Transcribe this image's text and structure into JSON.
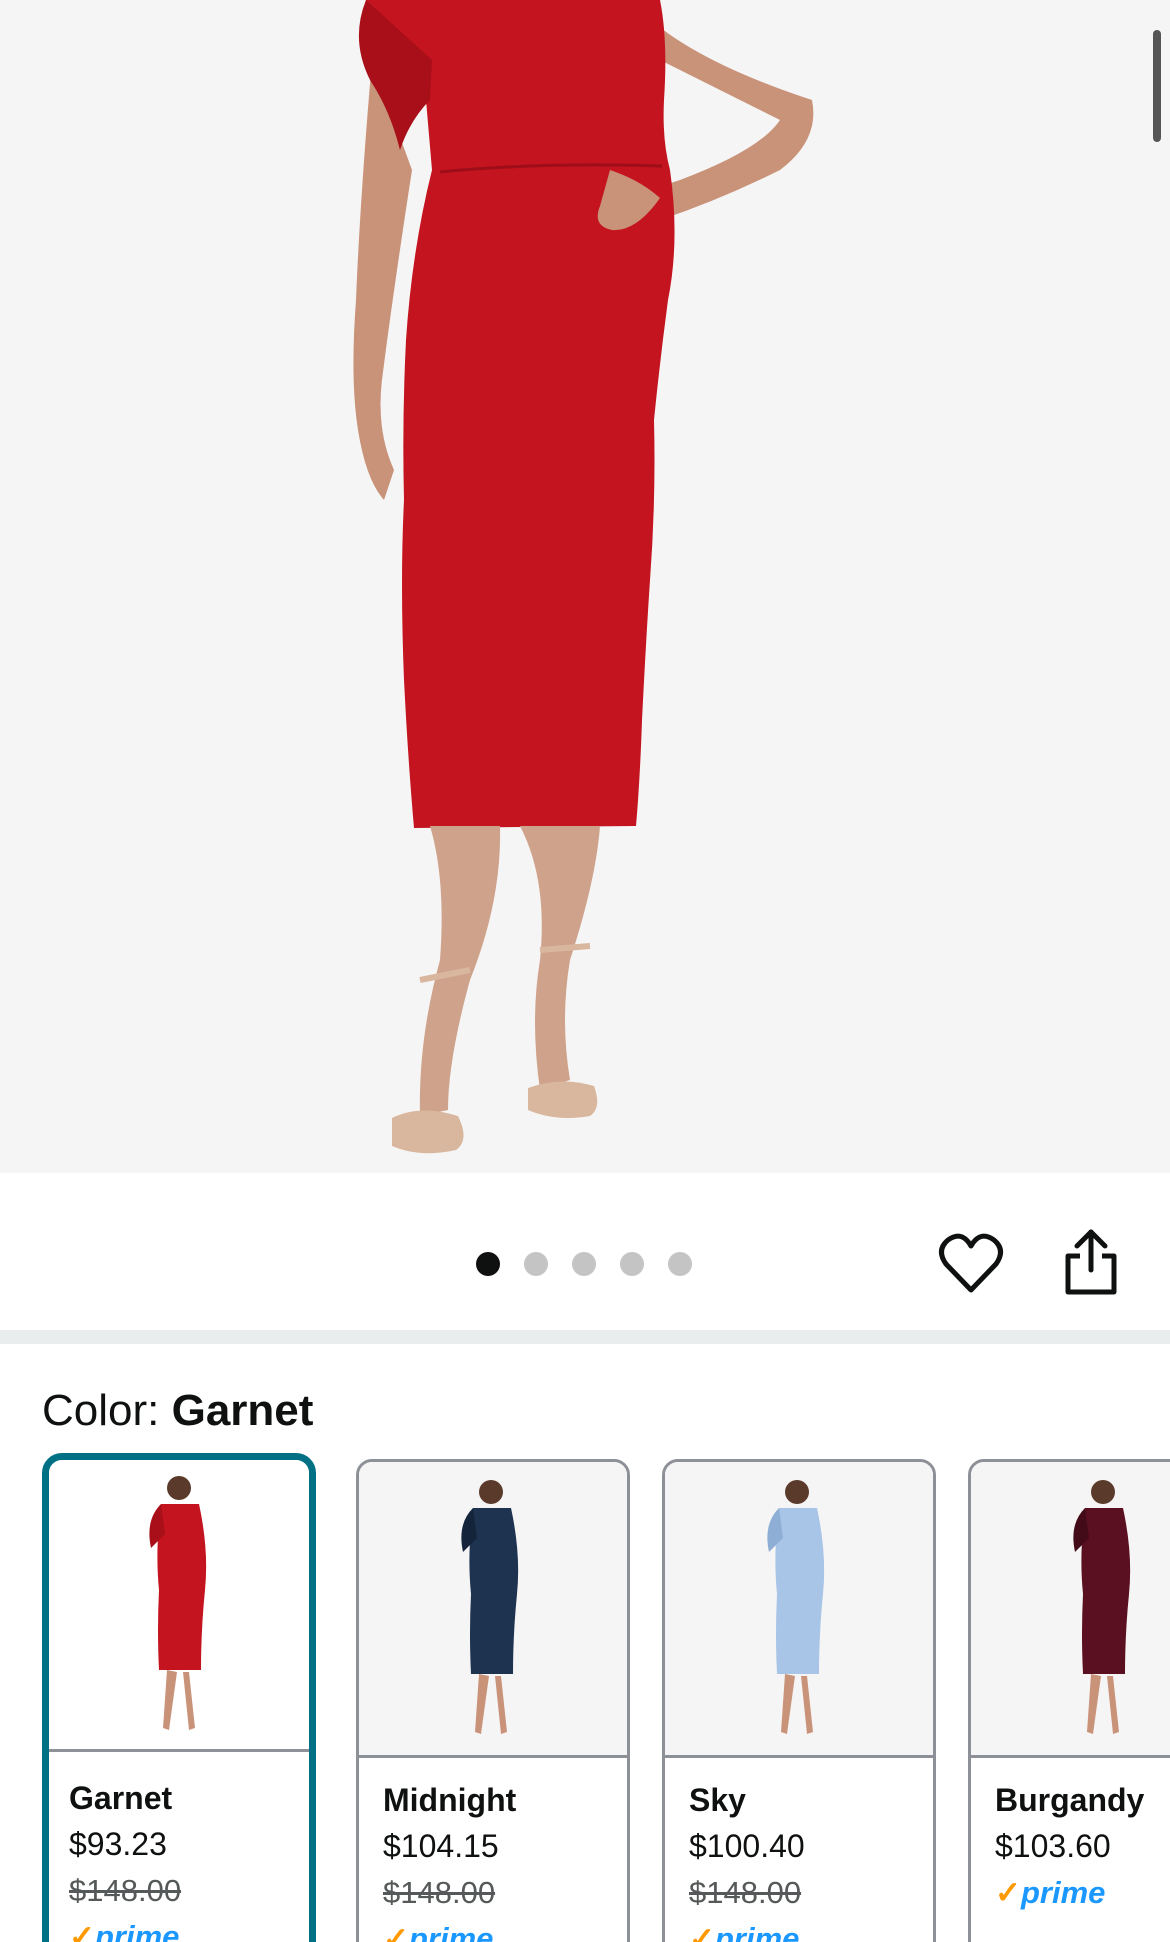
{
  "carousel": {
    "dot_count": 5,
    "active_index": 0
  },
  "colors": {
    "dress_selected": "#c4141f",
    "accent_teal": "#007185",
    "prime_blue": "#1a98ff"
  },
  "color_selector": {
    "label": "Color:",
    "selected": "Garnet",
    "options": [
      {
        "name": "Garnet",
        "price": "$93.23",
        "was": "$148.00",
        "prime": "prime",
        "swatch": "#c4141f"
      },
      {
        "name": "Midnight",
        "price": "$104.15",
        "was": "$148.00",
        "prime": "prime",
        "swatch": "#1e3350"
      },
      {
        "name": "Sky",
        "price": "$100.40",
        "was": "$148.00",
        "prime": "prime",
        "swatch": "#a8c4e6"
      },
      {
        "name": "Burgandy",
        "price": "$103.60",
        "was": "",
        "prime": "prime",
        "swatch": "#5a1020"
      }
    ]
  },
  "icons": {
    "favorite": "heart-outline-icon",
    "share": "share-icon"
  }
}
